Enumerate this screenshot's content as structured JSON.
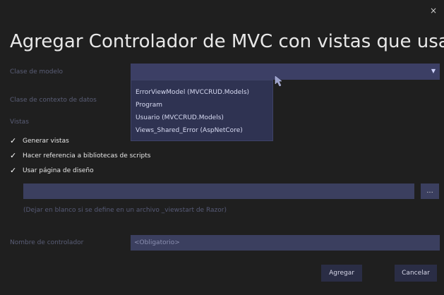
{
  "dialog": {
    "title": "Agregar Controlador de MVC con vistas que usan Entity Fran",
    "close_label": "×"
  },
  "form": {
    "model_class_label": "Clase de modelo",
    "data_context_label": "Clase de contexto de datos",
    "views_label": "Vistas",
    "dropdown_options": [
      "ErrorViewModel (MVCCRUD.Models)",
      "Program",
      "Usuario (MVCCRUD.Models)",
      "Views_Shared_Error (AspNetCore)"
    ],
    "checkboxes": [
      {
        "label": "Generar vistas",
        "checked": true
      },
      {
        "label": "Hacer referencia a bibliotecas de scripts",
        "checked": true
      },
      {
        "label": "Usar página de diseño",
        "checked": true
      }
    ],
    "layout_path_value": "",
    "browse_label": "...",
    "layout_hint": "(Dejar en blanco si se define en un archivo _viewstart de Razor)",
    "controller_name_label": "Nombre de controlador",
    "controller_name_placeholder": "<Obligatorio>"
  },
  "buttons": {
    "add_label": "Agregar",
    "cancel_label": "Cancelar"
  },
  "colors": {
    "background": "#1f1f1f",
    "field": "#3b3f5f",
    "dim_label": "#5a5e77"
  }
}
